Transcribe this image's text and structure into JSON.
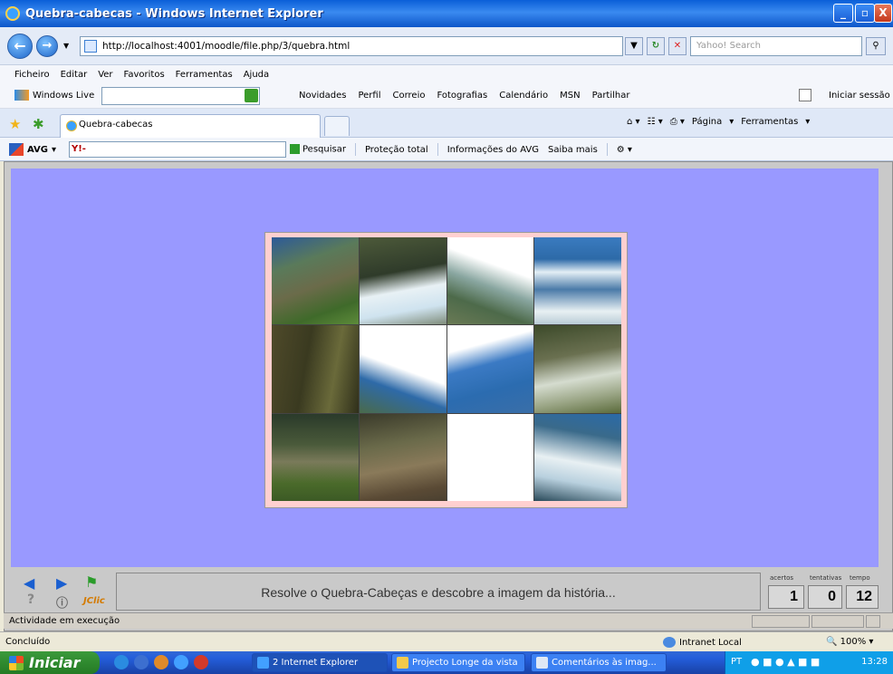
{
  "window": {
    "title": "Quebra-cabecas - Windows Internet Explorer",
    "controls": {
      "minimize": "_",
      "maximize": "▫",
      "close": "X"
    }
  },
  "address_bar": {
    "url": "http://localhost:4001/moodle/file.php/3/quebra.html",
    "search_placeholder": "Yahoo! Search"
  },
  "menu": [
    "Ficheiro",
    "Editar",
    "Ver",
    "Favoritos",
    "Ferramentas",
    "Ajuda"
  ],
  "windows_live": {
    "brand": "Windows Live",
    "links": [
      "Novidades",
      "Perfil",
      "Correio",
      "Fotografias",
      "Calendário",
      "MSN",
      "Partilhar"
    ],
    "signin": "Iniciar sessão"
  },
  "tabs": {
    "active_tab": "Quebra-cabecas",
    "commands": [
      "Página",
      "Ferramentas"
    ]
  },
  "avg_toolbar": {
    "brand": "AVG",
    "search": "Pesquisar",
    "protection": "Proteção total",
    "info": "Informações do AVG",
    "more": "Saiba mais"
  },
  "puzzle": {
    "rows": 3,
    "cols": 4,
    "pieces": [
      "mountain-ruins",
      "cliff-clouds",
      "white-sky",
      "mountain-mist",
      "cliff-dark",
      "sky-slope",
      "blue-peak",
      "cliff-fog",
      "ruins-terraces",
      "ruins-stone",
      "blank",
      "cloud-valley"
    ]
  },
  "jclic": {
    "message": "Resolve o Quebra-Cabeças e descobre a imagem da história...",
    "labels": {
      "hits": "acertos",
      "attempts": "tentativas",
      "time": "tempo"
    },
    "counters": {
      "hits": "1",
      "attempts": "0",
      "time": "12"
    },
    "logo": "JClic",
    "status": "Actividade em execução"
  },
  "status_bar": {
    "text": "Concluído",
    "zone": "Intranet Local",
    "zoom": "100%"
  },
  "taskbar": {
    "start": "Iniciar",
    "tasks": [
      "2 Internet Explorer",
      "Projecto Longe da vista",
      "Comentários às imag..."
    ],
    "language": "PT",
    "clock": "13:28"
  }
}
